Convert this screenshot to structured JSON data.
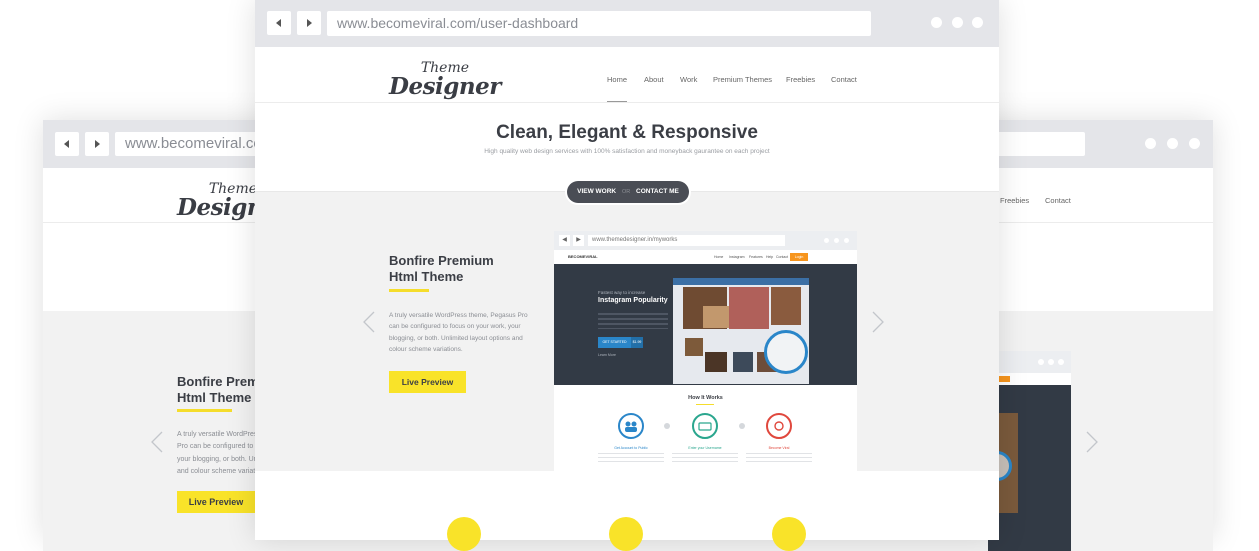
{
  "back_window": {
    "url": "www.becomeviral.com/user-dashboard",
    "logo": {
      "line1": "Theme",
      "line2": "Designer"
    },
    "nav": [
      "Freebies",
      "Contact"
    ],
    "product": {
      "title_line1": "Bonfire Premium",
      "title_line2": "Html Theme",
      "description": "A truly versatile WordPress theme, Pegasus Pro can be configured to focus on your work, your blogging, or both. Unlimited layout options and colour scheme variations.",
      "button": "Live Preview"
    }
  },
  "front_window": {
    "url": "www.becomeviral.com/user-dashboard",
    "logo": {
      "line1": "Theme",
      "line2": "Designer"
    },
    "nav": {
      "active": "Home",
      "items": [
        "Home",
        "About",
        "Work",
        "Premium Themes",
        "Freebies",
        "Contact"
      ]
    },
    "hero": {
      "title": "Clean, Elegant & Responsive",
      "subtitle": "High quality web design services with 100% satisfaction and moneyback gaurantee on each project"
    },
    "cta": {
      "view_work": "VIEW WORK",
      "or": "OR",
      "contact_me": "CONTACT ME"
    },
    "product": {
      "title_line1": "Bonfire Premium",
      "title_line2": "Html Theme",
      "description": "A truly versatile WordPress theme, Pegasus Pro can be configured to focus on your work, your blogging, or both. Unlimited layout options and colour scheme variations.",
      "button": "Live Preview"
    },
    "mockup": {
      "url": "www.themedesigner.in/myworks",
      "brand": "BECOMEVIRAL",
      "nav": [
        "Home",
        "Instagram",
        "Features",
        "Help",
        "Contact",
        "Login"
      ],
      "hero_small": "Fastest way to increase",
      "hero_title": "Instagram Popularity",
      "get_started": "GET STARTED",
      "price": "$1.99",
      "learn_more": "Learn More",
      "how_title": "How It Works",
      "steps": [
        "Get Account to Public",
        "Enter your Username",
        "Become Viral"
      ]
    }
  },
  "colors": {
    "accent": "#f9e329",
    "dark_button": "#4a4d55",
    "mockup_dark": "#323a45",
    "step_blue": "#2a86c9",
    "step_green": "#2aa68e",
    "step_red": "#e0483d"
  }
}
